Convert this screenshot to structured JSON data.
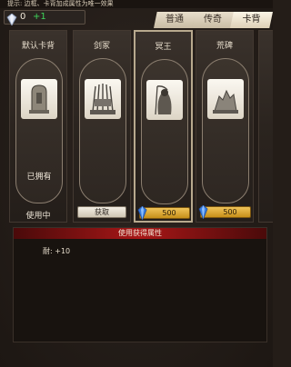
{
  "hint": "提示: 边框、卡背加成属性为唯一效果",
  "currency": {
    "amount": "0",
    "delta": "+1"
  },
  "tabs": [
    {
      "label": "普通",
      "active": false
    },
    {
      "label": "传奇",
      "active": false
    },
    {
      "label": "卡背",
      "active": true
    }
  ],
  "cards": [
    {
      "name": "默认卡背",
      "art": "tombstone",
      "owned_label": "已拥有",
      "status": "使用中"
    },
    {
      "name": "剑冢",
      "art": "sword-throne",
      "button": "获取"
    },
    {
      "name": "冥王",
      "art": "reaper",
      "price": "500",
      "selected": true
    },
    {
      "name": "荒碑",
      "art": "ruined-altar",
      "price": "500"
    }
  ],
  "attributes": {
    "header": "使用获得属性",
    "lines": [
      "耐: +10"
    ]
  },
  "colors": {
    "accent_red": "#a81717",
    "gold": "#e0a830",
    "gem_blue": "#3a7fe0"
  }
}
